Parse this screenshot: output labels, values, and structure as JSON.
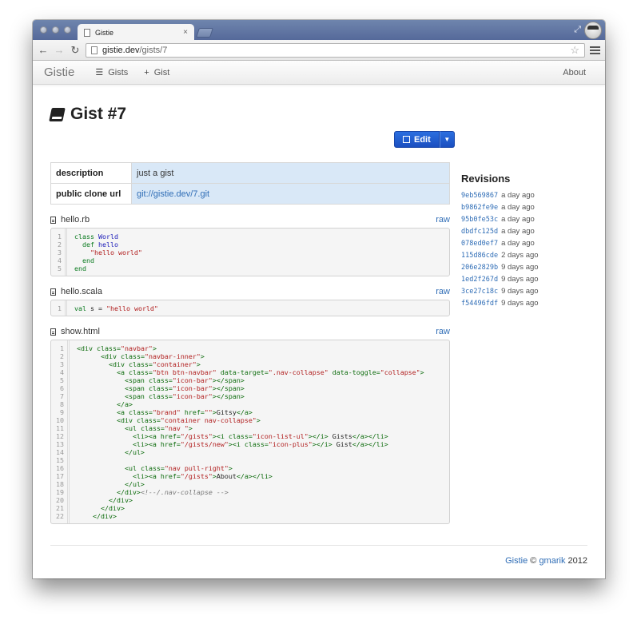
{
  "browser": {
    "tab_title": "Gistie",
    "tab_close": "×",
    "url_host": "gistie.dev",
    "url_path": "/gists/7"
  },
  "navbar": {
    "brand": "Gistie",
    "gists": "Gists",
    "add_gist": "Gist",
    "about": "About"
  },
  "page": {
    "title": "Gist #7",
    "edit_label": "Edit"
  },
  "meta": [
    {
      "key": "description",
      "value": "just a gist"
    },
    {
      "key": "public clone url",
      "value": "git://gistie.dev/7.git"
    }
  ],
  "files": [
    {
      "name": "hello.rb",
      "raw": "raw",
      "lines": [
        "1",
        "2",
        "3",
        "4",
        "5"
      ]
    },
    {
      "name": "hello.scala",
      "raw": "raw",
      "lines": [
        "1"
      ]
    },
    {
      "name": "show.html",
      "raw": "raw",
      "lines": [
        "1",
        "2",
        "3",
        "4",
        "5",
        "6",
        "7",
        "8",
        "9",
        "10",
        "11",
        "12",
        "13",
        "14",
        "15",
        "16",
        "17",
        "18",
        "19",
        "20",
        "21",
        "22"
      ]
    }
  ],
  "revisions": {
    "title": "Revisions",
    "items": [
      {
        "hash": "9eb569867",
        "age": "a day ago"
      },
      {
        "hash": "b9862fe9e",
        "age": "a day ago"
      },
      {
        "hash": "95b0fe53c",
        "age": "a day ago"
      },
      {
        "hash": "dbdfc125d",
        "age": "a day ago"
      },
      {
        "hash": "078ed0ef7",
        "age": "a day ago"
      },
      {
        "hash": "115d86cde",
        "age": "2 days ago"
      },
      {
        "hash": "206e2829b",
        "age": "9 days ago"
      },
      {
        "hash": "1ed2f267d",
        "age": "9 days ago"
      },
      {
        "hash": "3ce27c18c",
        "age": "9 days ago"
      },
      {
        "hash": "f54496fdf",
        "age": "9 days ago"
      }
    ]
  },
  "footer": {
    "brand": "Gistie",
    "copy": "©",
    "author": "gmarik",
    "year": "2012"
  }
}
